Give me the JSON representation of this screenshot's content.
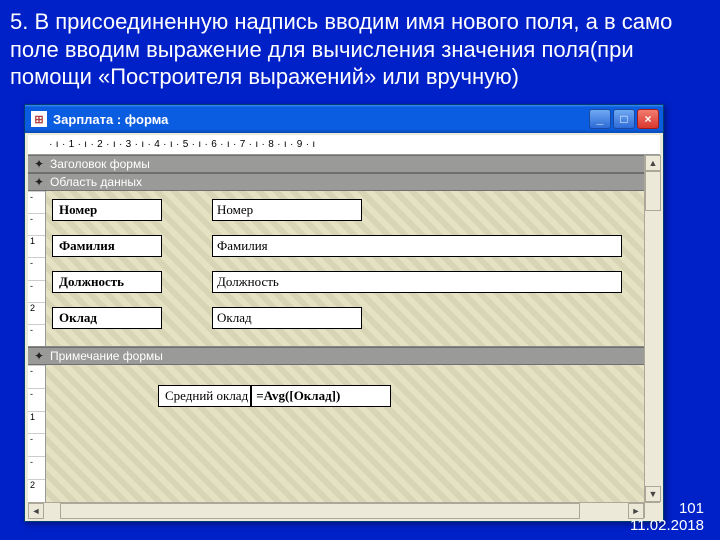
{
  "slide": {
    "text": "5. В присоединенную надпись вводим имя нового поля, а в само поле вводим выражение для вычисления значения поля(при помощи «Построителя выражений» или вручную)",
    "page": "101",
    "date": "11.02.2018"
  },
  "window": {
    "title": "Зарплата : форма",
    "ruler": " · ı · 1 · ı · 2 · ı · 3 · ı · 4 · ı · 5 · ı · 6 · ı · 7 · ı · 8 · ı · 9 · ı ",
    "sections": {
      "header": "Заголовок формы",
      "detail": "Область данных",
      "footer": "Примечание формы"
    },
    "vruler_detail": [
      "-",
      "-",
      "1",
      "-",
      "-",
      "2",
      "-"
    ],
    "vruler_footer": [
      "-",
      "-",
      "1",
      "-",
      "-",
      "2"
    ],
    "detail_rows": [
      {
        "label": "Номер",
        "field": "Номер",
        "w": "w1"
      },
      {
        "label": "Фамилия",
        "field": "Фамилия",
        "w": "w2"
      },
      {
        "label": "Должность",
        "field": "Должность",
        "w": "w2"
      },
      {
        "label": "Оклад",
        "field": "Оклад",
        "w": "w1"
      }
    ],
    "footer_row": {
      "label": "Средний оклад",
      "field": "=Avg([Оклад])"
    }
  }
}
